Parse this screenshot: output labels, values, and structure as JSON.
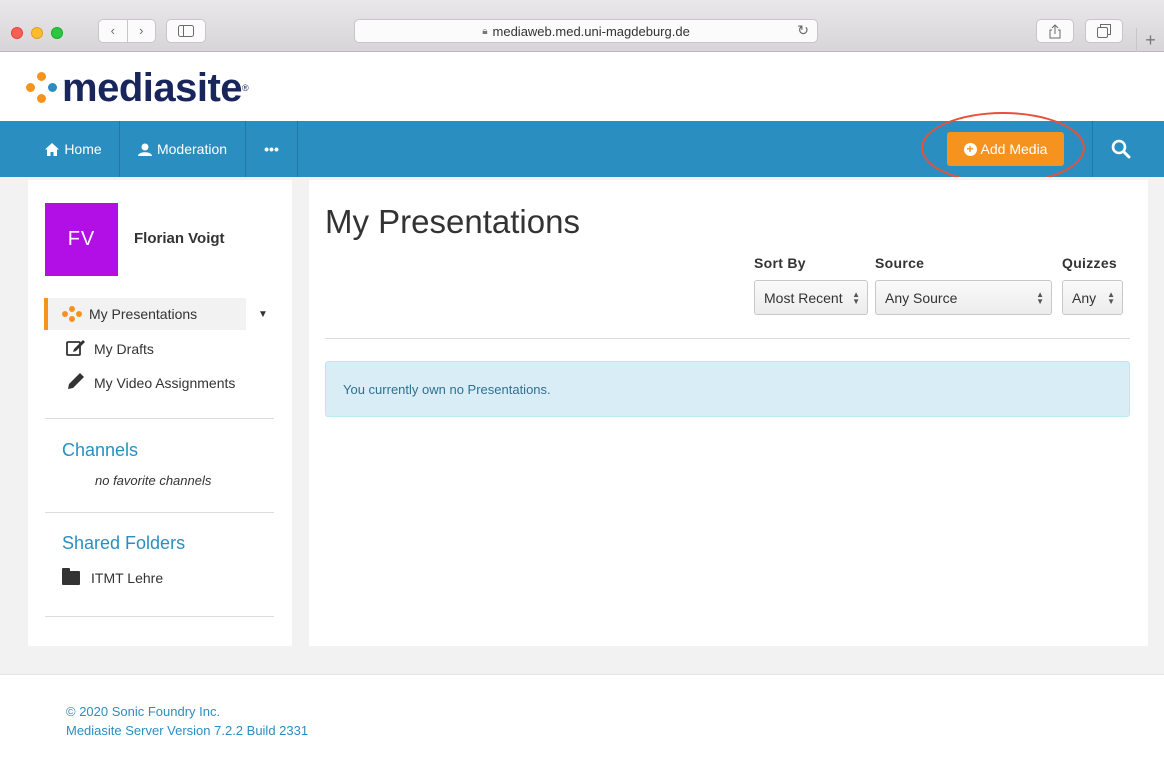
{
  "browser": {
    "url": "mediaweb.med.uni-magdeburg.de",
    "back_label": "‹",
    "forward_label": "›",
    "new_tab_label": "+"
  },
  "logo": {
    "text": "mediasite",
    "reg": "®"
  },
  "nav": {
    "home": "Home",
    "moderation": "Moderation",
    "more": "•••",
    "add_media": "Add Media"
  },
  "user": {
    "initials": "FV",
    "name": "Florian Voigt"
  },
  "sidebar": {
    "items": [
      {
        "label": "My Presentations",
        "icon": "mediasite-dots-icon"
      },
      {
        "label": "My Drafts",
        "icon": "edit-icon"
      },
      {
        "label": "My Video Assignments",
        "icon": "pencil-icon"
      }
    ],
    "channels_title": "Channels",
    "channels_empty": "no favorite channels",
    "shared_title": "Shared Folders",
    "shared_items": [
      {
        "label": "ITMT Lehre",
        "icon": "folder-icon"
      }
    ]
  },
  "main": {
    "title": "My Presentations",
    "filters": {
      "sort_label": "Sort By",
      "sort_value": "Most Recent",
      "source_label": "Source",
      "source_value": "Any Source",
      "quizzes_label": "Quizzes",
      "quizzes_value": "Any"
    },
    "empty_message": "You currently own no Presentations."
  },
  "footer": {
    "copyright": "© 2020 Sonic Foundry Inc.",
    "version": "Mediasite Server Version 7.2.2 Build 2331"
  },
  "colors": {
    "navbar": "#2a8fc0",
    "accent": "#f6931f",
    "avatar": "#b20ee6",
    "highlight_ellipse": "#e8503a"
  }
}
